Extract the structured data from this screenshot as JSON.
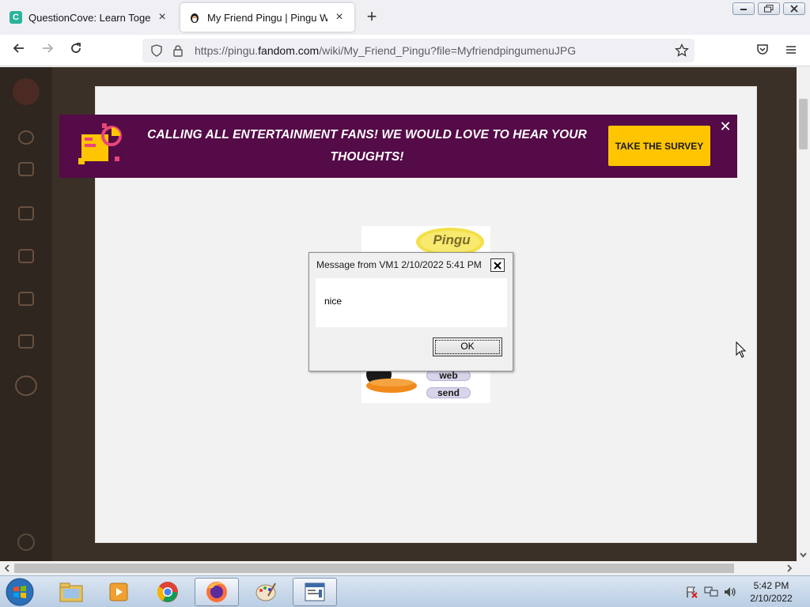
{
  "browser": {
    "tabs": [
      {
        "title": "QuestionCove: Learn Together",
        "favicon_letter": "C",
        "favicon_color": "#2bb39b",
        "active": false
      },
      {
        "title": "My Friend Pingu | Pingu Wiki | F",
        "favicon_letter": "",
        "active": true
      }
    ],
    "new_tab_symbol": "+",
    "url_prefix": "https://pingu.",
    "url_host": "fandom.com",
    "url_suffix": "/wiki/My_Friend_Pingu?file=MyfriendpingumenuJPG"
  },
  "banner": {
    "text": "CALLING ALL ENTERTAINMENT FANS! WE WOULD LOVE TO HEAR YOUR THOUGHTS!",
    "button_label": "TAKE THE SURVEY",
    "close_symbol": "✕",
    "background_color": "#540b47",
    "button_color": "#ffc500"
  },
  "image": {
    "logo_text": "Pingu",
    "menu_items": [
      "web",
      "send"
    ]
  },
  "dialog": {
    "title": "Message from VM1 2/10/2022 5:41 PM",
    "message": "nice",
    "ok_label": "OK",
    "close_symbol": "✕"
  },
  "taskbar": {
    "clock_time": "5:42 PM",
    "clock_date": "2/10/2022",
    "apps": [
      "file-explorer",
      "media-player",
      "chrome",
      "firefox",
      "paint",
      "message-app"
    ]
  }
}
